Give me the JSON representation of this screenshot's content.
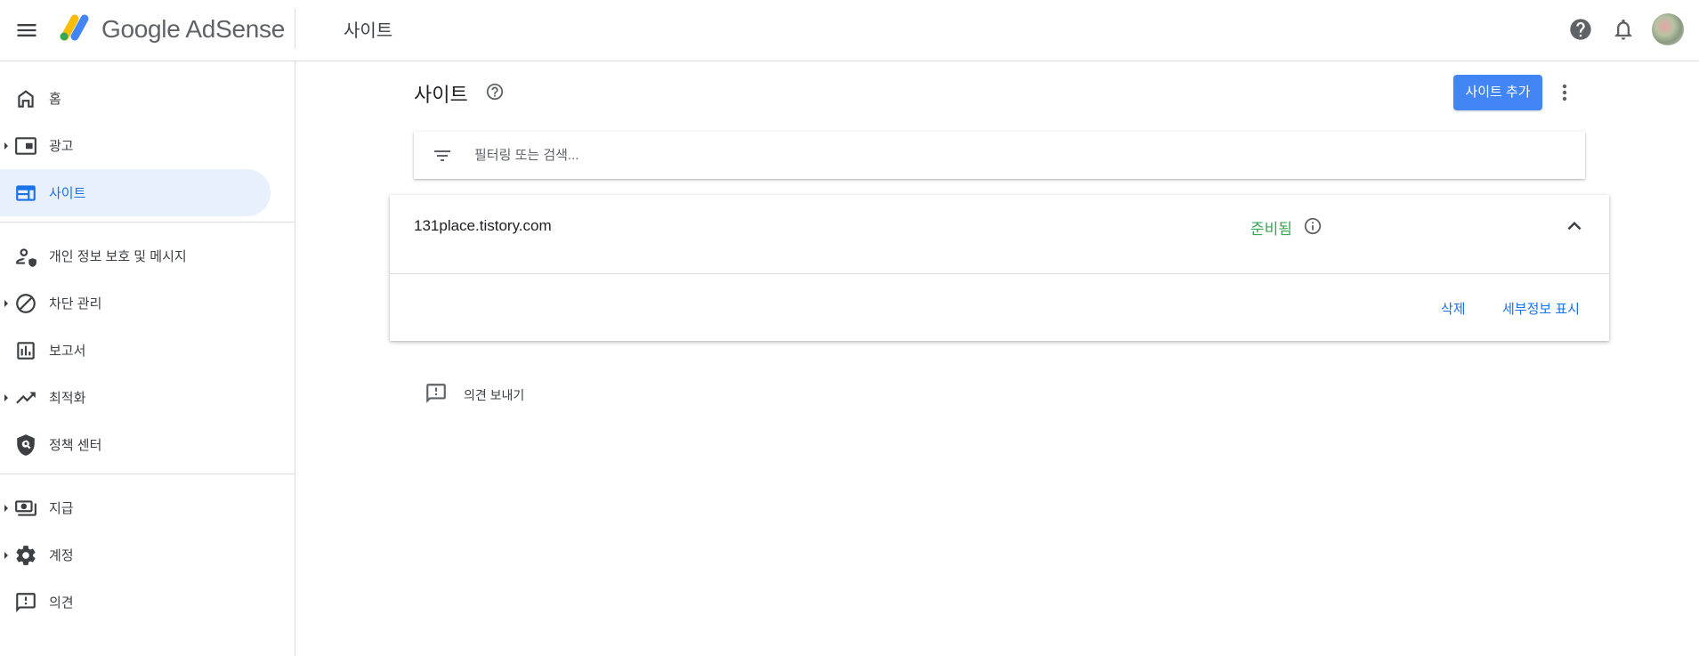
{
  "header": {
    "app_name": "Google AdSense",
    "section_title": "사이트"
  },
  "sidebar": {
    "items": [
      {
        "label": "홈",
        "icon": "home-icon",
        "has_caret": false,
        "active": false
      },
      {
        "label": "광고",
        "icon": "ads-icon",
        "has_caret": true,
        "active": false
      },
      {
        "label": "사이트",
        "icon": "sites-icon",
        "has_caret": false,
        "active": true
      },
      {
        "label": "개인 정보 보호 및 메시지",
        "icon": "privacy-icon",
        "has_caret": false,
        "active": false
      },
      {
        "label": "차단 관리",
        "icon": "block-icon",
        "has_caret": true,
        "active": false
      },
      {
        "label": "보고서",
        "icon": "reports-icon",
        "has_caret": false,
        "active": false
      },
      {
        "label": "최적화",
        "icon": "optimization-icon",
        "has_caret": true,
        "active": false
      },
      {
        "label": "정책 센터",
        "icon": "policy-shield-icon",
        "has_caret": false,
        "active": false
      },
      {
        "label": "지급",
        "icon": "payments-icon",
        "has_caret": true,
        "active": false
      },
      {
        "label": "계정",
        "icon": "gear-icon",
        "has_caret": true,
        "active": false
      },
      {
        "label": "의견",
        "icon": "feedback-icon",
        "has_caret": false,
        "active": false
      }
    ]
  },
  "main": {
    "title": "사이트",
    "add_site_label": "사이트 추가",
    "filter": {
      "placeholder": "필터링 또는 검색...",
      "value": ""
    },
    "sites": [
      {
        "domain": "131place.tistory.com",
        "status": "준비됨",
        "delete_label": "삭제",
        "details_label": "세부정보 표시"
      }
    ],
    "feedback_label": "의견 보내기"
  },
  "colors": {
    "accent": "#1a73e8",
    "button": "#4285f4",
    "status_ready": "#34a853",
    "active_bg": "#e8f0fe"
  }
}
